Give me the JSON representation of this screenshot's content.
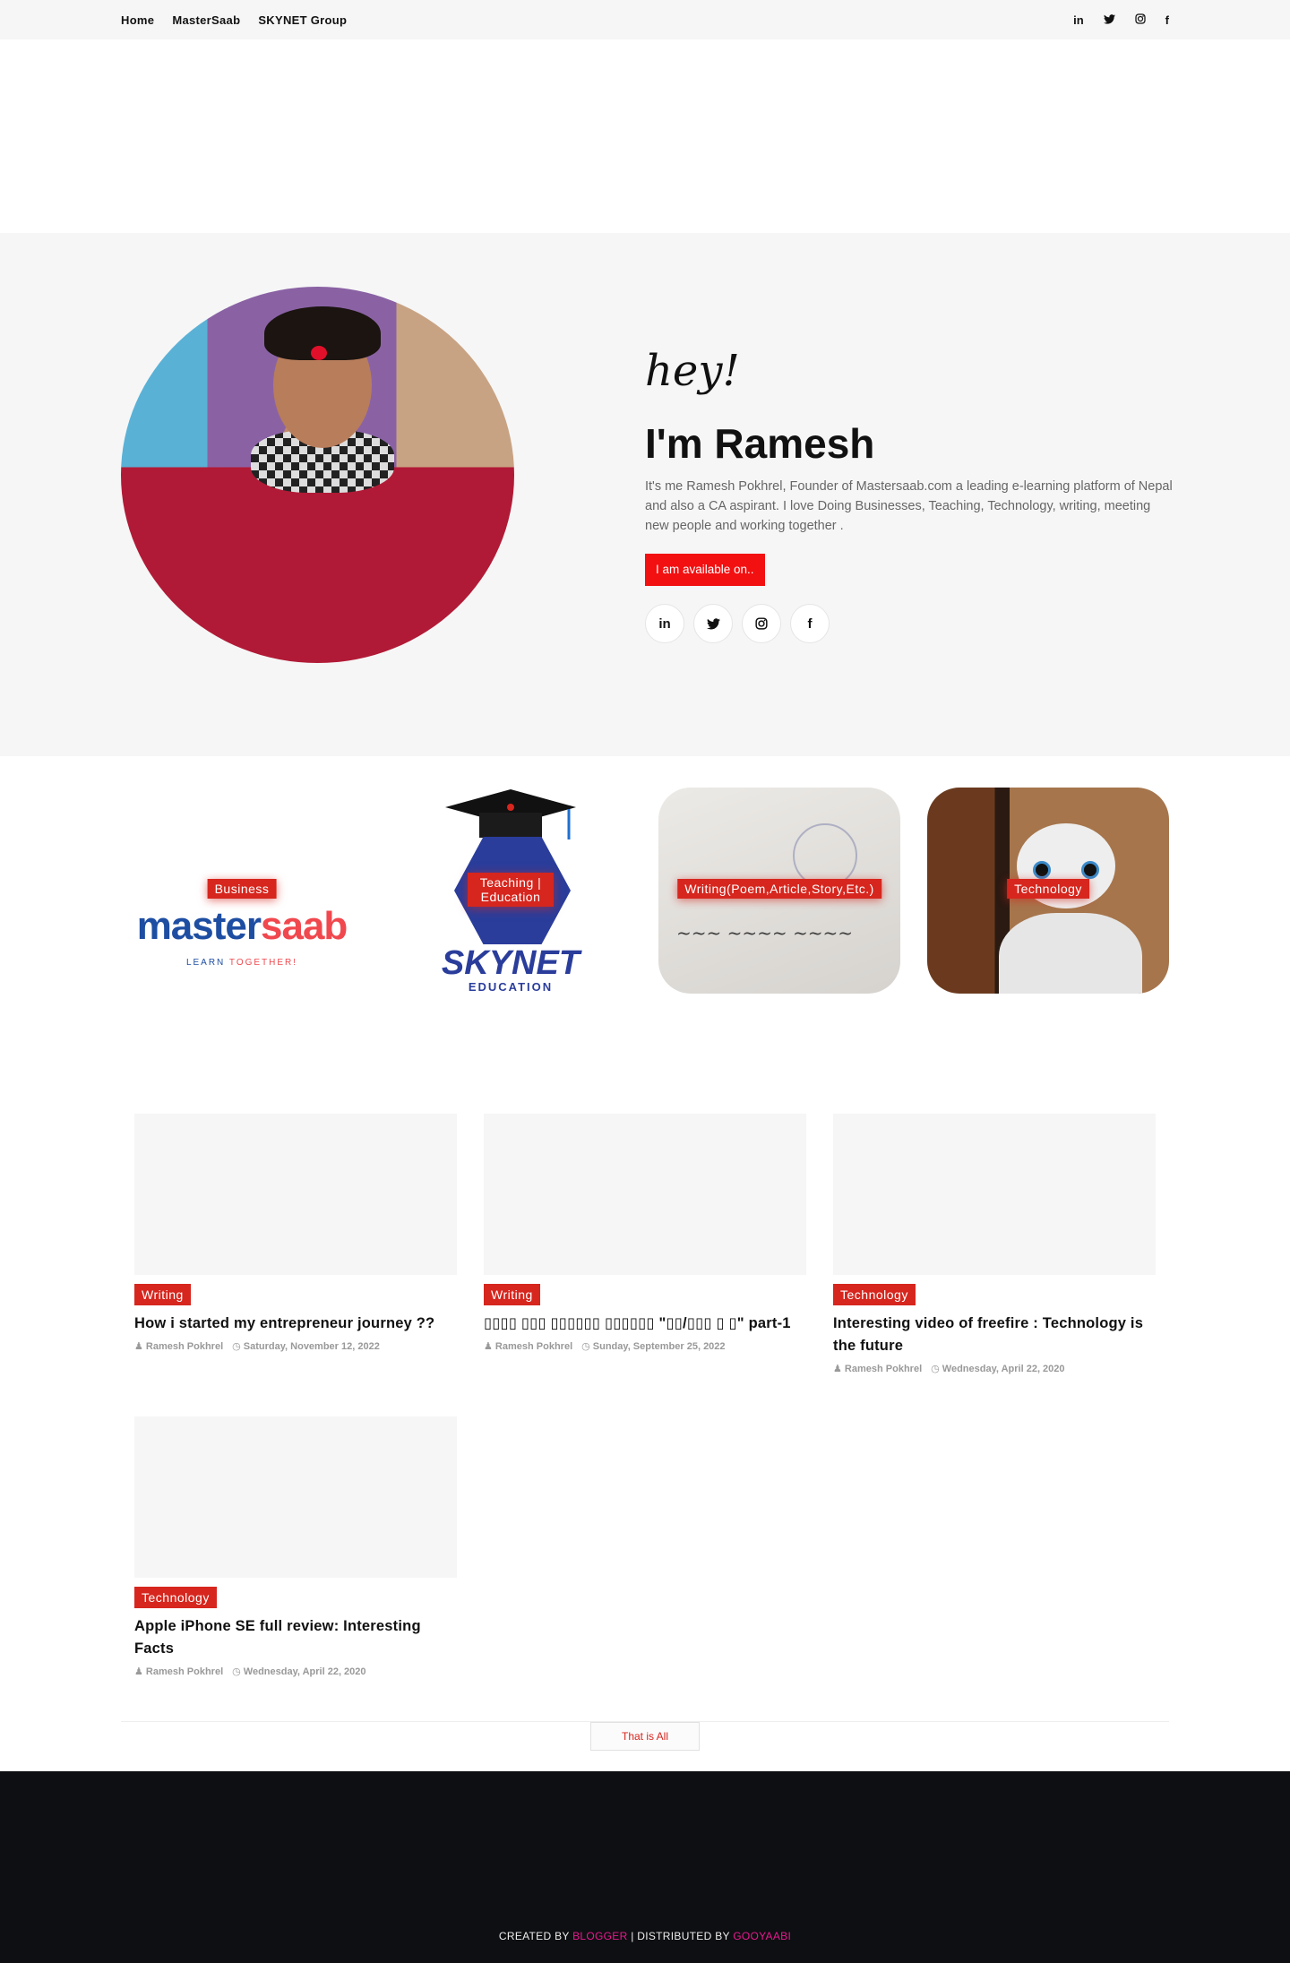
{
  "nav": {
    "items": [
      "Home",
      "MasterSaab",
      "SKYNET Group"
    ],
    "social_icons": [
      "linkedin-icon",
      "twitter-icon",
      "instagram-icon",
      "facebook-icon"
    ]
  },
  "hero": {
    "greeting": "hey!",
    "heading": "I'm Ramesh",
    "bio": "It's me Ramesh Pokhrel, Founder of Mastersaab.com a leading e-learning platform of Nepal and also a CA aspirant. I love Doing Businesses, Teaching, Technology, writing, meeting new people and working together .",
    "cta_label": "I am available on..",
    "social_icons": [
      "linkedin-icon",
      "twitter-icon",
      "instagram-icon",
      "facebook-icon"
    ],
    "accent_color": "#f21011"
  },
  "categories": [
    {
      "label": "Business",
      "logo_text_a": "master",
      "logo_text_b": "saab",
      "logo_tag_a": "LEARN ",
      "logo_tag_b": "TOGETHER!"
    },
    {
      "label": "Teaching | Education",
      "logo_text": "SKYNET",
      "logo_sub": "EDUCATION"
    },
    {
      "label": "Writing(Poem,Article,Story,Etc.)"
    },
    {
      "label": "Technology"
    }
  ],
  "posts": [
    {
      "label": "Writing",
      "title": "How i started my entrepreneur journey ??",
      "author": "Ramesh Pokhrel",
      "date": "Saturday, November 12, 2022"
    },
    {
      "label": "Writing",
      "title": "▯▯▯▯ ▯▯▯ ▯▯▯▯▯▯ ▯▯▯▯▯▯ \"▯▯/▯▯▯ ▯ ▯\" part-1",
      "author": "Ramesh Pokhrel",
      "date": "Sunday, September 25, 2022"
    },
    {
      "label": "Technology",
      "title": "Interesting video of freefire : Technology is the future",
      "author": "Ramesh Pokhrel",
      "date": "Wednesday, April 22, 2020"
    },
    {
      "label": "Technology",
      "title": "Apple iPhone SE full review: Interesting Facts",
      "author": "Ramesh Pokhrel",
      "date": "Wednesday, April 22, 2020"
    }
  ],
  "load_more": "That is All",
  "footer": {
    "created_by": "CREATED BY",
    "blogger": "BLOGGER",
    "distributed_by": "| DISTRIBUTED BY",
    "gooyaabi": "GOOYAABI",
    "brand_color": "#e6198f"
  }
}
